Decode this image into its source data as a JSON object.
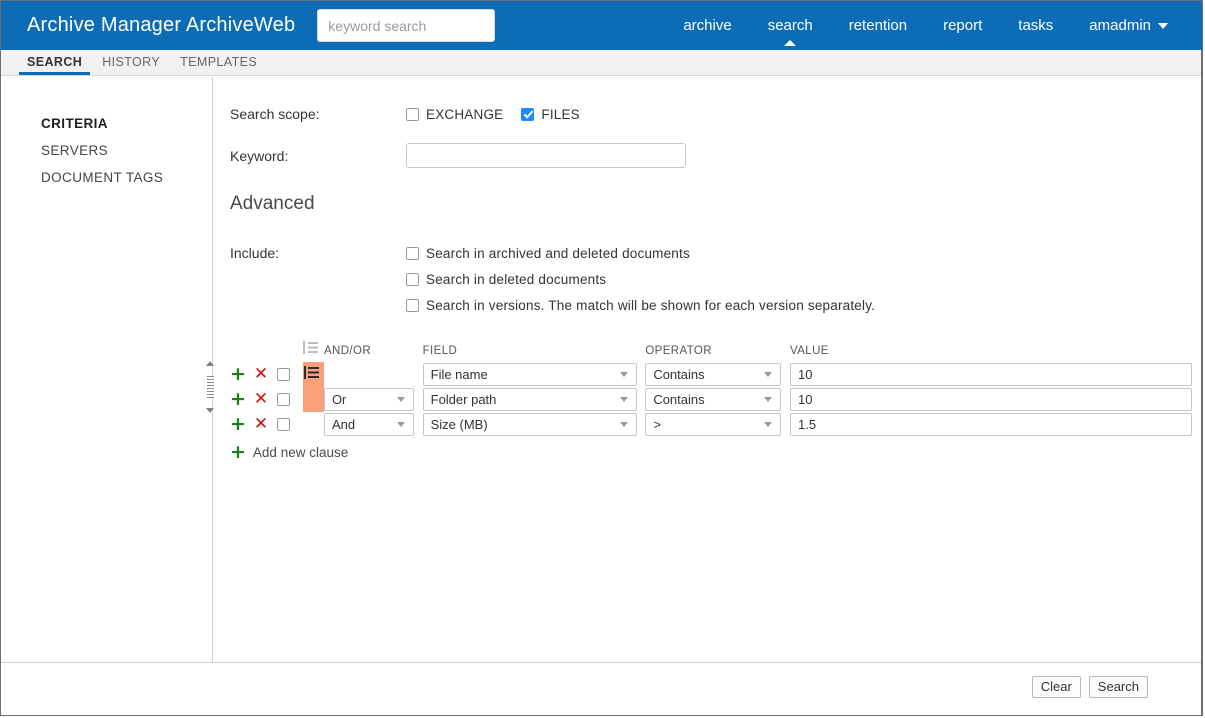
{
  "header": {
    "brand": "Archive Manager ArchiveWeb",
    "search_placeholder": "keyword search",
    "search_value": "",
    "nav": [
      {
        "label": "archive",
        "active": false
      },
      {
        "label": "search",
        "active": true
      },
      {
        "label": "retention",
        "active": false
      },
      {
        "label": "report",
        "active": false
      },
      {
        "label": "tasks",
        "active": false
      }
    ],
    "user": "amadmin"
  },
  "subtabs": [
    {
      "label": "SEARCH",
      "active": true
    },
    {
      "label": "HISTORY",
      "active": false
    },
    {
      "label": "TEMPLATES",
      "active": false
    }
  ],
  "sidebar": {
    "items": [
      {
        "label": "CRITERIA",
        "active": true
      },
      {
        "label": "SERVERS",
        "active": false
      },
      {
        "label": "DOCUMENT TAGS",
        "active": false
      }
    ]
  },
  "main": {
    "scope_label": "Search scope:",
    "scope_options": [
      {
        "label": "EXCHANGE",
        "checked": false
      },
      {
        "label": "FILES",
        "checked": true
      }
    ],
    "keyword_label": "Keyword:",
    "keyword_value": "",
    "keyword_placeholder": "",
    "advanced_title": "Advanced",
    "include_label": "Include:",
    "include_options": [
      {
        "label": "Search in archived and deleted documents",
        "checked": false
      },
      {
        "label": "Search in deleted documents",
        "checked": false
      },
      {
        "label": "Search in versions. The match will be shown for each version separately.",
        "checked": false
      }
    ],
    "clause_headers": {
      "group": "",
      "andor": "AND/OR",
      "field": "FIELD",
      "operator": "OPERATOR",
      "value": "VALUE"
    },
    "clauses": [
      {
        "andor": "",
        "field": "File name",
        "operator": "Contains",
        "value": "10",
        "checked": false,
        "grouped": true
      },
      {
        "andor": "Or",
        "field": "Folder path",
        "operator": "Contains",
        "value": "10",
        "checked": false,
        "grouped": true
      },
      {
        "andor": "And",
        "field": "Size (MB)",
        "operator": ">",
        "value": "1.5",
        "checked": false,
        "grouped": false
      }
    ],
    "add_clause_label": "Add new clause",
    "icons": {
      "add_row": "+",
      "remove_row": "✕"
    }
  },
  "footer": {
    "clear_label": "Clear",
    "search_label": "Search"
  },
  "colors": {
    "brand_blue": "#0d6cb6",
    "accent_checkbox": "#1a8cff",
    "group_highlight": "#f9a07a",
    "add_green": "#168116",
    "remove_red": "#cc1111"
  }
}
